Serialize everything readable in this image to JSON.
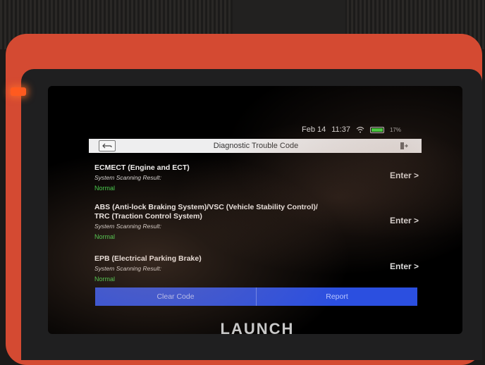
{
  "status": {
    "date": "Feb 14",
    "time": "11:37",
    "battery": "17%"
  },
  "header": {
    "title": "Diagnostic Trouble Code"
  },
  "systems": [
    {
      "name_lines": [
        "ECMECT (Engine and ECT)"
      ],
      "result_label": "System Scanning Result:",
      "result": "Normal",
      "enter_label": "Enter >"
    },
    {
      "name_lines": [
        "ABS (Anti-lock Braking System)/VSC (Vehicle Stability Control)/",
        "TRC (Traction Control System)"
      ],
      "result_label": "System Scanning Result:",
      "result": "Normal",
      "enter_label": "Enter >"
    },
    {
      "name_lines": [
        "EPB (Electrical Parking Brake)"
      ],
      "result_label": "System Scanning Result:",
      "result": "Normal",
      "enter_label": "Enter >"
    }
  ],
  "actions": {
    "clear_code": "Clear Code",
    "report": "Report"
  },
  "brand": "LAUNCH",
  "colors": {
    "shell": "#d44a32",
    "action_bar": "#2b4fe0",
    "normal": "#3ed04a",
    "battery": "#3cd43c"
  }
}
